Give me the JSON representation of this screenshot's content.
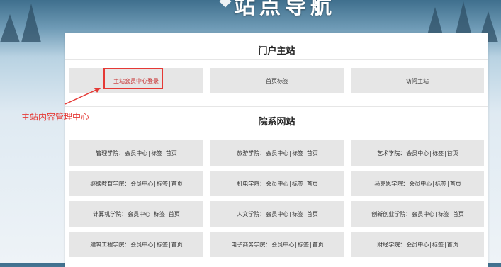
{
  "banner": {
    "title": "站点导航"
  },
  "portal": {
    "heading": "门户主站",
    "links": [
      {
        "label": "主站会员中心登录"
      },
      {
        "label": "首页标签"
      },
      {
        "label": "访问主站"
      }
    ]
  },
  "annotation": {
    "text": "主站内容管理中心",
    "color": "#e53935"
  },
  "departments": {
    "heading": "院系网站",
    "sep": "|",
    "member_label": "会员中心",
    "tag_label": "标签",
    "home_label": "首页",
    "items": [
      {
        "name": "管理学院："
      },
      {
        "name": "旅游学院："
      },
      {
        "name": "艺术学院："
      },
      {
        "name": "继续教育学院："
      },
      {
        "name": "机电学院："
      },
      {
        "name": "马克思学院："
      },
      {
        "name": "计算机学院："
      },
      {
        "name": "人文学院："
      },
      {
        "name": "创新创业学院："
      },
      {
        "name": "建筑工程学院："
      },
      {
        "name": "电子商务学院："
      },
      {
        "name": "财经学院："
      }
    ]
  }
}
